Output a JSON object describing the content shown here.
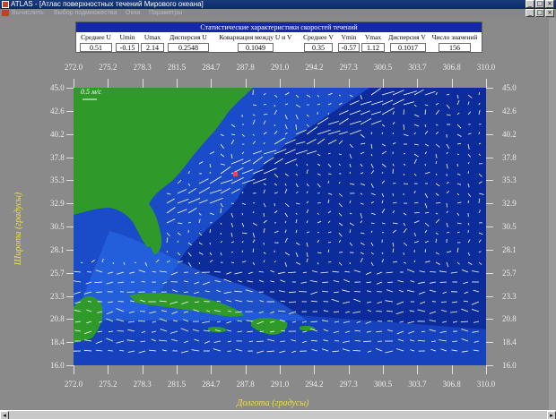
{
  "window": {
    "title": "ATLAS - [Атлас поверхностных течений Мирового океана]",
    "min": "_",
    "max": "□",
    "close": "×"
  },
  "menu": {
    "items": [
      "Вычислить",
      "Выбор подмножества",
      "Окна",
      "Параметры"
    ]
  },
  "stats": {
    "title": "Статистические характеристики скоростей течений",
    "columns": [
      {
        "header": "Среднее U",
        "value": "0.51"
      },
      {
        "header": "Umin",
        "value": "-0.15"
      },
      {
        "header": "Umax",
        "value": "2.14"
      },
      {
        "header": "Дисперсия U",
        "value": "0.2548"
      },
      {
        "header": "Ковариация между U и V",
        "value": "0.1049"
      },
      {
        "header": "Среднее V",
        "value": "0.35"
      },
      {
        "header": "Vmin",
        "value": "-0.57"
      },
      {
        "header": "Vmax",
        "value": "1.12"
      },
      {
        "header": "Дисперсия V",
        "value": "0.1017"
      },
      {
        "header": "Число значений",
        "value": "156"
      }
    ]
  },
  "map": {
    "scale_label": "0.5 м/с",
    "lon_ticks": [
      "272.0",
      "275.2",
      "278.3",
      "281.5",
      "284.7",
      "287.8",
      "291.0",
      "294.2",
      "297.3",
      "300.5",
      "303.7",
      "306.8",
      "310.0"
    ],
    "lat_ticks": [
      "45.0",
      "42.6",
      "40.2",
      "37.8",
      "35.3",
      "32.9",
      "30.5",
      "28.1",
      "25.7",
      "23.3",
      "20.8",
      "18.4",
      "16.0"
    ],
    "xlabel": "Долгота (градусы)",
    "ylabel": "Широта (градусы)",
    "colors": {
      "ocean_deep": "#0d2c9c",
      "ocean_shelf": "#2060e0",
      "land": "#2f9a2a",
      "vectors": "#ffffff",
      "marker": "#ff4040"
    }
  }
}
